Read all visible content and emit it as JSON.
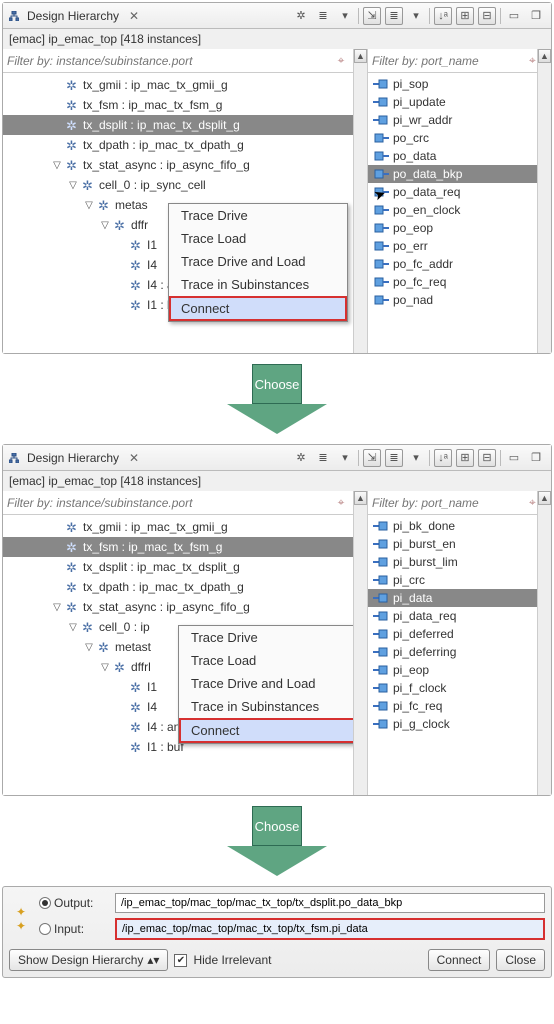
{
  "panel_title": "Design Hierarchy",
  "subtitle": "[emac] ip_emac_top [418 instances]",
  "filter_left_ph": "Filter by: instance/subinstance.port",
  "filter_right_ph": "Filter by: port_name",
  "tree1": [
    {
      "indent": 3,
      "icon": "gear",
      "label": "tx_gmii : ip_mac_tx_gmii_g"
    },
    {
      "indent": 3,
      "icon": "gear",
      "label": "tx_fsm : ip_mac_tx_fsm_g"
    },
    {
      "indent": 3,
      "icon": "gear",
      "label": "tx_dsplit : ip_mac_tx_dsplit_g",
      "selected": true
    },
    {
      "indent": 3,
      "icon": "gear",
      "label": "tx_dpath : ip_mac_tx_dpath_g"
    },
    {
      "indent": 3,
      "icon": "gear",
      "label": "tx_stat_async : ip_async_fifo_g",
      "exp": "▽"
    },
    {
      "indent": 4,
      "icon": "gear",
      "label": "cell_0 : ip_sync_cell",
      "exp": "▽"
    },
    {
      "indent": 5,
      "icon": "gear",
      "label": "metas",
      "exp": "▽"
    },
    {
      "indent": 6,
      "icon": "gear",
      "label": "dffr",
      "exp": "▽"
    },
    {
      "indent": 7,
      "icon": "gear",
      "label": "I1"
    },
    {
      "indent": 7,
      "icon": "gear",
      "label": "I4"
    },
    {
      "indent": 7,
      "icon": "gear",
      "label": "I4 : and"
    },
    {
      "indent": 7,
      "icon": "gear",
      "label": "I1 : buf"
    }
  ],
  "tree2": [
    {
      "indent": 3,
      "icon": "gear",
      "label": "tx_gmii : ip_mac_tx_gmii_g"
    },
    {
      "indent": 3,
      "icon": "gear",
      "label": "tx_fsm : ip_mac_tx_fsm_g",
      "selected": true
    },
    {
      "indent": 3,
      "icon": "gear",
      "label": "tx_dsplit : ip_mac_tx_dsplit_g"
    },
    {
      "indent": 3,
      "icon": "gear",
      "label": "tx_dpath : ip_mac_tx_dpath_g"
    },
    {
      "indent": 3,
      "icon": "gear",
      "label": "tx_stat_async : ip_async_fifo_g",
      "exp": "▽"
    },
    {
      "indent": 4,
      "icon": "gear",
      "label": "cell_0 : ip",
      "exp": "▽"
    },
    {
      "indent": 5,
      "icon": "gear",
      "label": "metast",
      "exp": "▽"
    },
    {
      "indent": 6,
      "icon": "gear",
      "label": "dffrl",
      "exp": "▽"
    },
    {
      "indent": 7,
      "icon": "gear",
      "label": "I1"
    },
    {
      "indent": 7,
      "icon": "gear",
      "label": "I4"
    },
    {
      "indent": 7,
      "icon": "gear",
      "label": "I4 : and"
    },
    {
      "indent": 7,
      "icon": "gear",
      "label": "I1 : buf"
    }
  ],
  "ports1": [
    {
      "dir": "in",
      "name": "pi_sop"
    },
    {
      "dir": "in",
      "name": "pi_update"
    },
    {
      "dir": "in",
      "name": "pi_wr_addr"
    },
    {
      "dir": "out",
      "name": "po_crc"
    },
    {
      "dir": "out",
      "name": "po_data"
    },
    {
      "dir": "out",
      "name": "po_data_bkp",
      "selected": true
    },
    {
      "dir": "out",
      "name": "po_data_req"
    },
    {
      "dir": "out",
      "name": "po_en_clock"
    },
    {
      "dir": "out",
      "name": "po_eop"
    },
    {
      "dir": "out",
      "name": "po_err"
    },
    {
      "dir": "out",
      "name": "po_fc_addr"
    },
    {
      "dir": "out",
      "name": "po_fc_req"
    },
    {
      "dir": "out",
      "name": "po_nad"
    }
  ],
  "ports2": [
    {
      "dir": "in",
      "name": "pi_bk_done"
    },
    {
      "dir": "in",
      "name": "pi_burst_en"
    },
    {
      "dir": "in",
      "name": "pi_burst_lim"
    },
    {
      "dir": "in",
      "name": "pi_crc"
    },
    {
      "dir": "in",
      "name": "pi_data",
      "selected": true
    },
    {
      "dir": "in",
      "name": "pi_data_req"
    },
    {
      "dir": "in",
      "name": "pi_deferred"
    },
    {
      "dir": "in",
      "name": "pi_deferring"
    },
    {
      "dir": "in",
      "name": "pi_eop"
    },
    {
      "dir": "in",
      "name": "pi_f_clock"
    },
    {
      "dir": "in",
      "name": "pi_fc_req"
    },
    {
      "dir": "in",
      "name": "pi_g_clock"
    }
  ],
  "menu": {
    "items": [
      "Trace Drive",
      "Trace Load",
      "Trace Drive and Load",
      "Trace in Subinstances"
    ],
    "highlighted": "Connect"
  },
  "arrow_label": "Choose",
  "bottom": {
    "output_label": "Output:",
    "input_label": "Input:",
    "output_path": "/ip_emac_top/mac_top/mac_tx_top/tx_dsplit.po_data_bkp",
    "input_path": "/ip_emac_top/mac_top/mac_tx_top/tx_fsm.pi_data",
    "dropdown": "Show Design Hierarchy",
    "checkbox": "Hide Irrelevant",
    "connect": "Connect",
    "close": "Close"
  }
}
